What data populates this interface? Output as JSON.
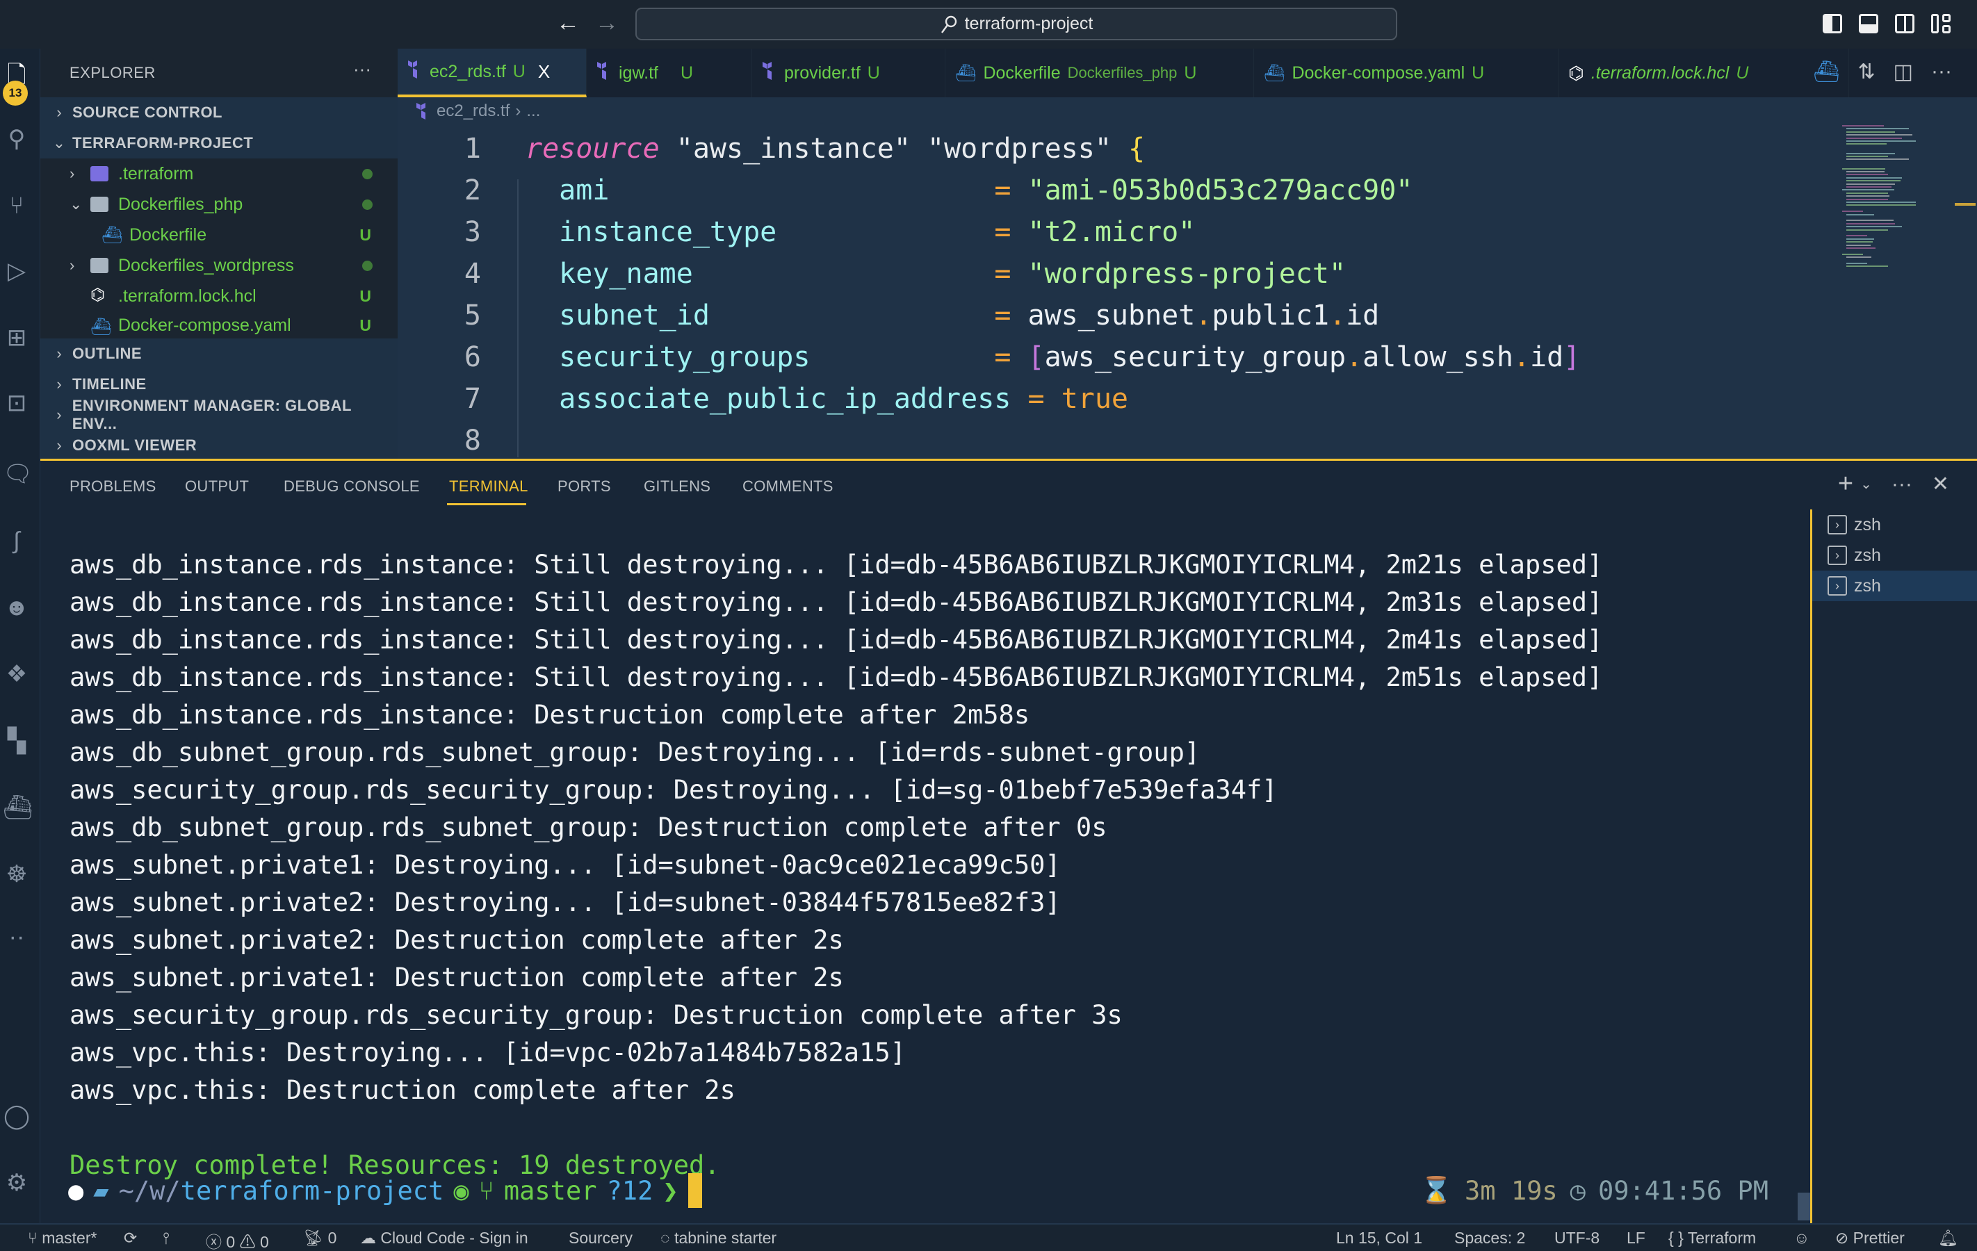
{
  "titlebar": {
    "search_label": "terraform-project",
    "icons": [
      "arrow-left-icon",
      "arrow-right-icon",
      "search-icon",
      "toggle-sidebar-icon",
      "toggle-panel-icon",
      "toggle-secondary-sidebar-icon",
      "customize-layout-icon"
    ]
  },
  "activity_bar": {
    "explorer_badge": "13",
    "icons": [
      "explorer-icon",
      "search-icon",
      "source-control-icon",
      "run-debug-icon",
      "extensions-icon",
      "remote-explorer-icon",
      "chat-icon",
      "python-icon",
      "copilot-icon",
      "dropbox-icon",
      "terraform-icon",
      "docker-icon",
      "kubernetes-icon",
      "more-icon",
      "account-icon",
      "settings-gear-icon"
    ]
  },
  "sidebar": {
    "title": "EXPLORER",
    "more": "···",
    "sections": {
      "source_control": "SOURCE CONTROL",
      "project": "TERRAFORM-PROJECT",
      "outline": "OUTLINE",
      "timeline": "TIMELINE",
      "env_manager": "ENVIRONMENT MANAGER: GLOBAL ENV...",
      "ooxml": "OOXML VIEWER"
    },
    "tree": [
      {
        "name": ".terraform",
        "type": "folder",
        "expanded": false,
        "status": "dot"
      },
      {
        "name": "Dockerfiles_php",
        "type": "folder",
        "expanded": true,
        "status": "dot"
      },
      {
        "name": "Dockerfile",
        "type": "docker-file",
        "status": "U"
      },
      {
        "name": "Dockerfiles_wordpress",
        "type": "folder",
        "expanded": false,
        "status": "dot"
      },
      {
        "name": ".terraform.lock.hcl",
        "type": "hcl-file",
        "status": "U"
      },
      {
        "name": "Docker-compose.yaml",
        "type": "docker-file",
        "status": "U"
      }
    ]
  },
  "tabs": [
    {
      "name": "ec2_rds.tf",
      "desc": "",
      "status": "U",
      "active": true,
      "close": "X"
    },
    {
      "name": "igw.tf",
      "desc": "",
      "status": "U"
    },
    {
      "name": "provider.tf",
      "desc": "",
      "status": "U"
    },
    {
      "name": "Dockerfile",
      "desc": "Dockerfiles_php",
      "status": "U"
    },
    {
      "name": "Docker-compose.yaml",
      "desc": "",
      "status": "U"
    },
    {
      "name": ".terraform.lock.hcl",
      "desc": "",
      "status": "U"
    }
  ],
  "breadcrumb": {
    "file": "ec2_rds.tf",
    "sep": "›",
    "rest": "..."
  },
  "editor": {
    "lines": [
      {
        "n": "1",
        "kw": "resource",
        "s1": "\"aws_instance\"",
        "s2": "\"wordpress\"",
        "brace": "{"
      },
      {
        "n": "2",
        "attr": "ami",
        "pad": "                       ",
        "val": "\"ami-053b0d53c279acc90\"",
        "vtype": "str"
      },
      {
        "n": "3",
        "attr": "instance_type",
        "pad": "             ",
        "val": "\"t2.micro\"",
        "vtype": "str"
      },
      {
        "n": "4",
        "attr": "key_name",
        "pad": "                  ",
        "val": "\"wordpress-project\"",
        "vtype": "str"
      },
      {
        "n": "5",
        "attr": "subnet_id",
        "pad": "                 ",
        "ref": [
          "aws_subnet",
          "public1",
          "id"
        ]
      },
      {
        "n": "6",
        "attr": "security_groups",
        "pad": "           ",
        "ref": [
          "aws_security_group",
          "allow_ssh",
          "id"
        ],
        "list": true
      },
      {
        "n": "7",
        "attr": "associate_public_ip_address",
        "pad": " ",
        "val": "true",
        "vtype": "bool"
      },
      {
        "n": "8"
      }
    ]
  },
  "panel": {
    "tabs": [
      "PROBLEMS",
      "OUTPUT",
      "DEBUG CONSOLE",
      "TERMINAL",
      "PORTS",
      "GITLENS",
      "COMMENTS"
    ],
    "active_tab": "TERMINAL",
    "terminals": [
      "zsh",
      "zsh",
      "zsh"
    ],
    "active_terminal": 2,
    "terminal_lines": [
      "aws_db_instance.rds_instance: Still destroying... [id=db-45B6AB6IUBZLRJKGMOIYICRLM4, 2m21s elapsed]",
      "aws_db_instance.rds_instance: Still destroying... [id=db-45B6AB6IUBZLRJKGMOIYICRLM4, 2m31s elapsed]",
      "aws_db_instance.rds_instance: Still destroying... [id=db-45B6AB6IUBZLRJKGMOIYICRLM4, 2m41s elapsed]",
      "aws_db_instance.rds_instance: Still destroying... [id=db-45B6AB6IUBZLRJKGMOIYICRLM4, 2m51s elapsed]",
      "aws_db_instance.rds_instance: Destruction complete after 2m58s",
      "aws_db_subnet_group.rds_subnet_group: Destroying... [id=rds-subnet-group]",
      "aws_security_group.rds_security_group: Destroying... [id=sg-01bebf7e539efa34f]",
      "aws_db_subnet_group.rds_subnet_group: Destruction complete after 0s",
      "aws_subnet.private1: Destroying... [id=subnet-0ac9ce021eca99c50]",
      "aws_subnet.private2: Destroying... [id=subnet-03844f57815ee82f3]",
      "aws_subnet.private2: Destruction complete after 2s",
      "aws_subnet.private1: Destruction complete after 2s",
      "aws_security_group.rds_security_group: Destruction complete after 3s",
      "aws_vpc.this: Destroying... [id=vpc-02b7a1484b7582a15]",
      "aws_vpc.this: Destruction complete after 2s"
    ],
    "summary": "Destroy complete! Resources: 19 destroyed.",
    "prompt": {
      "dir_prefix": "~/w/",
      "dir_name": "terraform-project",
      "branch": "master",
      "untracked": "?12",
      "arrow": "❯",
      "duration": "3m 19s",
      "time": "09:41:56 PM"
    }
  },
  "statusbar": {
    "branch": "master*",
    "errors": "0",
    "warnings": "0",
    "ports": "0",
    "cloud_code": "Cloud Code - Sign in",
    "sourcery": "Sourcery",
    "tabnine": "tabnine starter",
    "position": "Ln 15, Col 1",
    "spaces": "Spaces: 2",
    "encoding": "UTF-8",
    "eol": "LF",
    "language": "Terraform",
    "prettier": "Prettier"
  },
  "colors": {
    "accent": "#f2c233",
    "git_untracked": "#6cd04a",
    "background": "#1b2530",
    "editor_bg": "#1f3247",
    "panel_bg": "#182637"
  }
}
